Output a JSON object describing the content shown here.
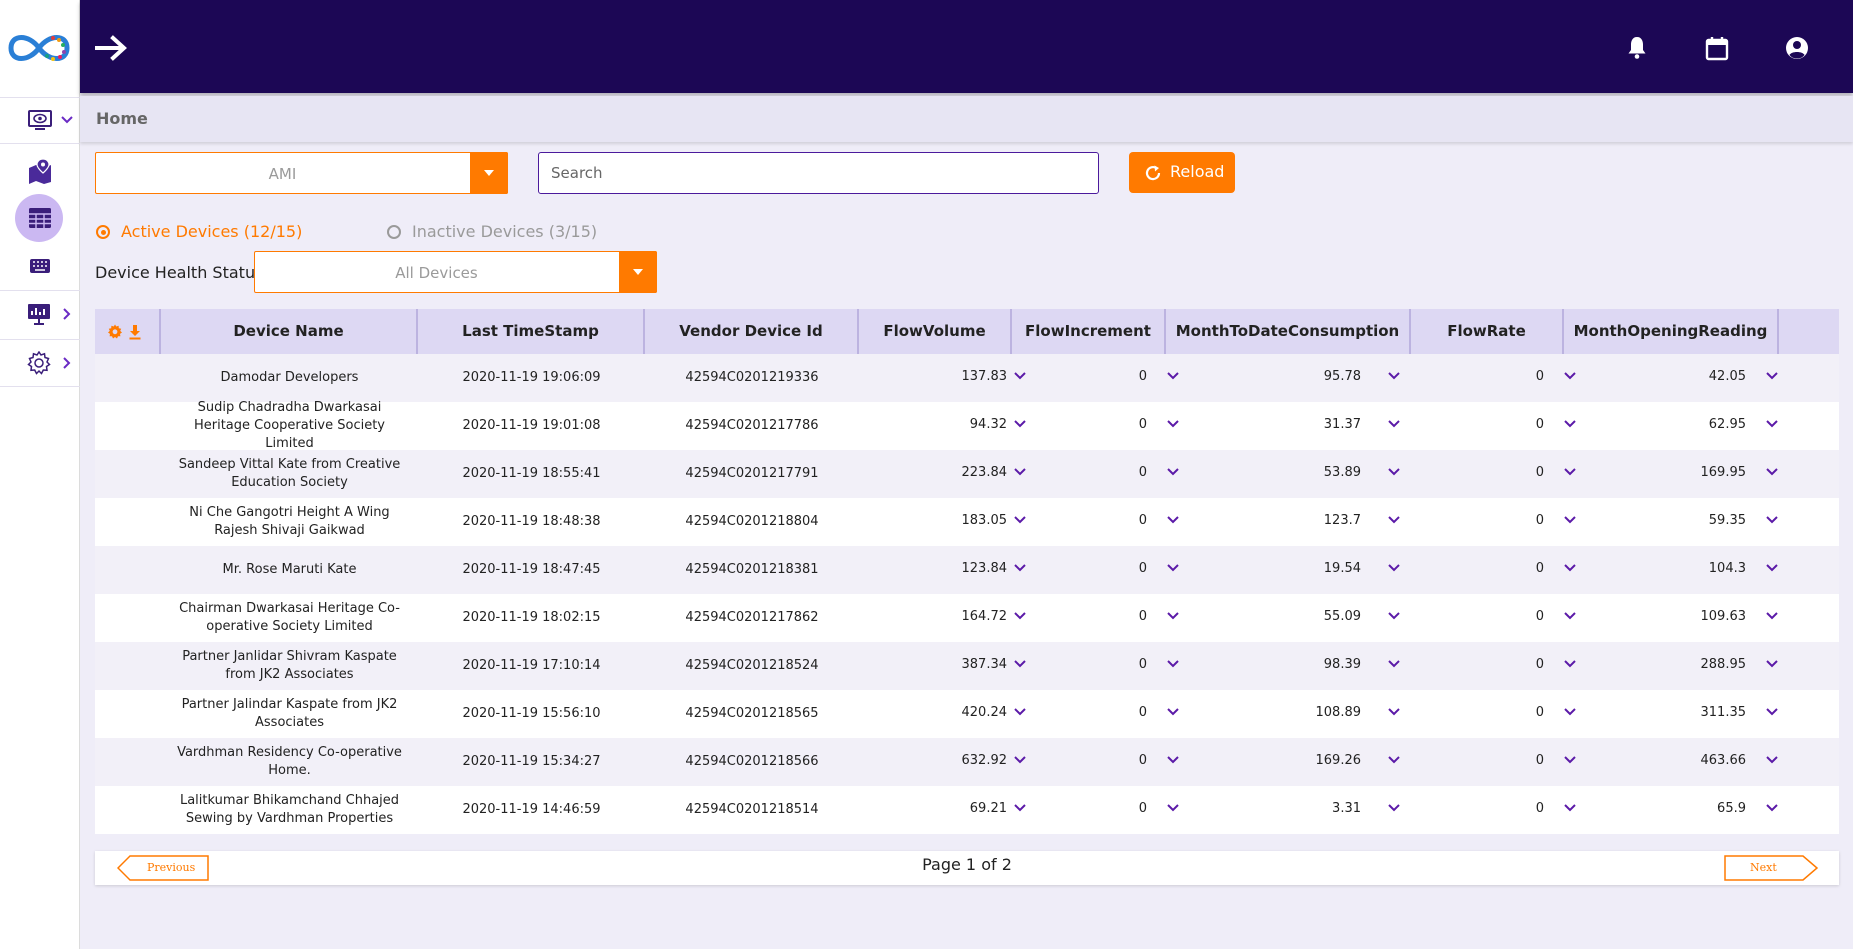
{
  "header": {
    "menu_icon": "arrow-right-icon",
    "icons": [
      "bell-icon",
      "calendar-icon",
      "account-circle-icon"
    ]
  },
  "sidebar": {
    "items": [
      {
        "icon": "monitor-eye-icon"
      },
      {
        "icon": "map-marker-icon"
      },
      {
        "icon": "table-grid-icon"
      },
      {
        "icon": "keyboard-icon"
      },
      {
        "icon": "presentation-chart-icon"
      },
      {
        "icon": "settings-gear-icon"
      }
    ]
  },
  "breadcrumb": {
    "title": "Home"
  },
  "filters": {
    "type_select": "AMI",
    "search_placeholder": "Search",
    "reload_label": "Reload",
    "active_radio": "Active Devices (12/15)",
    "inactive_radio": "Inactive Devices (3/15)",
    "health_label": "Device Health Status",
    "health_select": "All Devices"
  },
  "table": {
    "columns": [
      "Device Name",
      "Last TimeStamp",
      "Vendor Device Id",
      "FlowVolume",
      "FlowIncrement",
      "MonthToDateConsumption",
      "FlowRate",
      "MonthOpeningReading"
    ],
    "rows": [
      {
        "name": "Damodar Developers",
        "ts": "2020-11-19 19:06:09",
        "id": "42594C0201219336",
        "fv": "137.83",
        "fi": "0",
        "mtd": "95.78",
        "fr": "0",
        "mor": "42.05"
      },
      {
        "name": "Sudip Chadradha Dwarkasai Heritage Cooperative Society Limited",
        "ts": "2020-11-19 19:01:08",
        "id": "42594C0201217786",
        "fv": "94.32",
        "fi": "0",
        "mtd": "31.37",
        "fr": "0",
        "mor": "62.95"
      },
      {
        "name": "Sandeep Vittal Kate from Creative Education Society",
        "ts": "2020-11-19 18:55:41",
        "id": "42594C0201217791",
        "fv": "223.84",
        "fi": "0",
        "mtd": "53.89",
        "fr": "0",
        "mor": "169.95"
      },
      {
        "name": "Ni Che Gangotri Height A Wing Rajesh Shivaji Gaikwad",
        "ts": "2020-11-19 18:48:38",
        "id": "42594C0201218804",
        "fv": "183.05",
        "fi": "0",
        "mtd": "123.7",
        "fr": "0",
        "mor": "59.35"
      },
      {
        "name": "Mr. Rose Maruti Kate",
        "ts": "2020-11-19 18:47:45",
        "id": "42594C0201218381",
        "fv": "123.84",
        "fi": "0",
        "mtd": "19.54",
        "fr": "0",
        "mor": "104.3"
      },
      {
        "name": "Chairman Dwarkasai Heritage Co-operative Society Limited",
        "ts": "2020-11-19 18:02:15",
        "id": "42594C0201217862",
        "fv": "164.72",
        "fi": "0",
        "mtd": "55.09",
        "fr": "0",
        "mor": "109.63"
      },
      {
        "name": "Partner Janlidar Shivram Kaspate from JK2 Associates",
        "ts": "2020-11-19 17:10:14",
        "id": "42594C0201218524",
        "fv": "387.34",
        "fi": "0",
        "mtd": "98.39",
        "fr": "0",
        "mor": "288.95"
      },
      {
        "name": "Partner Jalindar Kaspate from JK2 Associates",
        "ts": "2020-11-19 15:56:10",
        "id": "42594C0201218565",
        "fv": "420.24",
        "fi": "0",
        "mtd": "108.89",
        "fr": "0",
        "mor": "311.35"
      },
      {
        "name": "Vardhman Residency Co-operative Home.",
        "ts": "2020-11-19 15:34:27",
        "id": "42594C0201218566",
        "fv": "632.92",
        "fi": "0",
        "mtd": "169.26",
        "fr": "0",
        "mor": "463.66"
      },
      {
        "name": "Lalitkumar Bhikamchand Chhajed Sewing by Vardhman Properties",
        "ts": "2020-11-19 14:46:59",
        "id": "42594C0201218514",
        "fv": "69.21",
        "fi": "0",
        "mtd": "3.31",
        "fr": "0",
        "mor": "65.9"
      }
    ]
  },
  "pagination": {
    "previous_label": "Previous",
    "next_label": "Next",
    "page_info": "Page 1 of 2"
  },
  "colors": {
    "header_bg": "#1c0755",
    "accent": "#ff7a00",
    "purple": "#5b1aa8",
    "table_header_bg": "#ddd8f3",
    "row_alt_bg": "#f2f0f8"
  }
}
